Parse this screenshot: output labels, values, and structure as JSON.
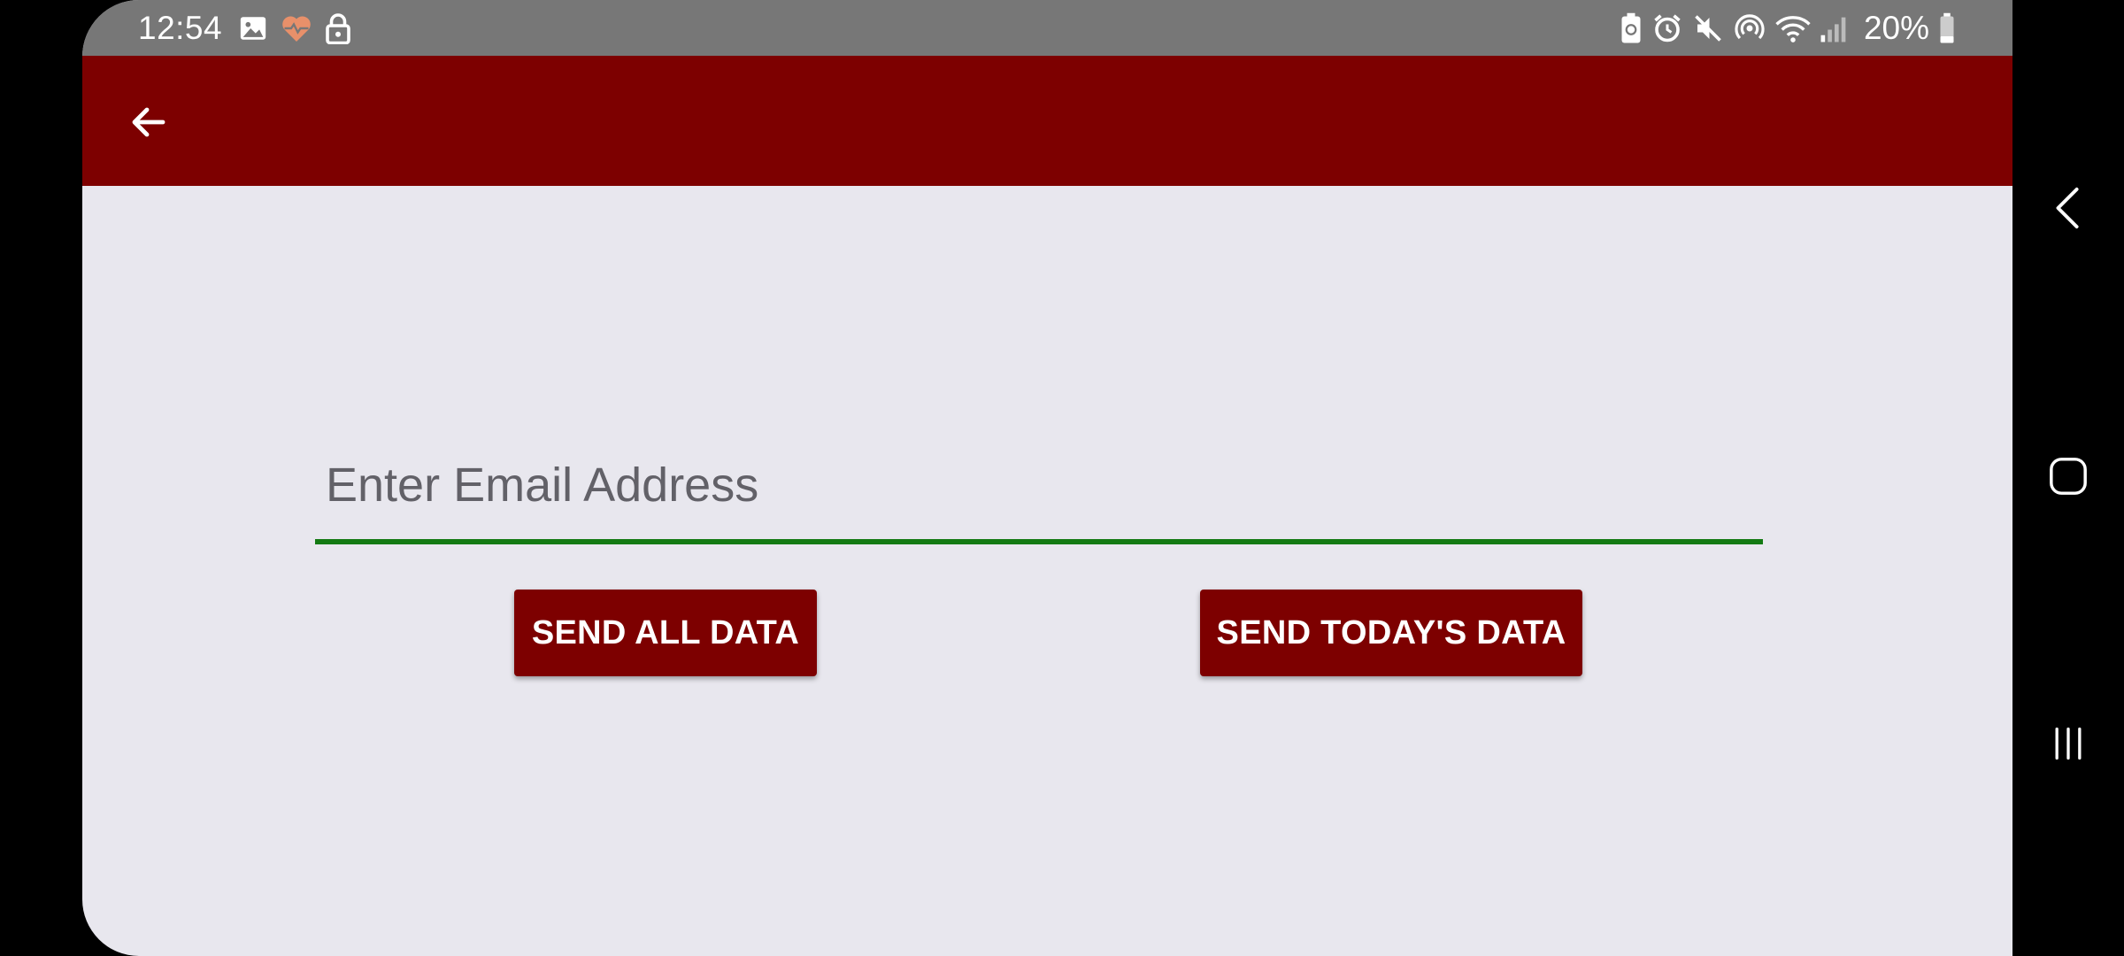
{
  "status_bar": {
    "time": "12:54",
    "battery": "20%",
    "left_icons": [
      "image-icon",
      "health-icon",
      "lock-icon"
    ],
    "right_icons": [
      "battery-saver-icon",
      "alarm-icon",
      "mute-icon",
      "hotspot-icon",
      "wifi-icon",
      "signal-icon",
      "battery-icon"
    ]
  },
  "app_bar": {
    "back_icon": "back-arrow-icon"
  },
  "form": {
    "email_placeholder": "Enter Email Address",
    "email_value": ""
  },
  "actions": {
    "send_all_label": "SEND ALL DATA",
    "send_today_label": "SEND TODAY'S DATA"
  },
  "navigation": {
    "items": [
      "back-icon",
      "home-icon",
      "recents-icon"
    ]
  },
  "colors": {
    "primary": "#7d0000",
    "background": "#e8e7ee",
    "status_bar": "#777777",
    "field_underline": "#137a13",
    "health_icon": "#e8906a"
  }
}
